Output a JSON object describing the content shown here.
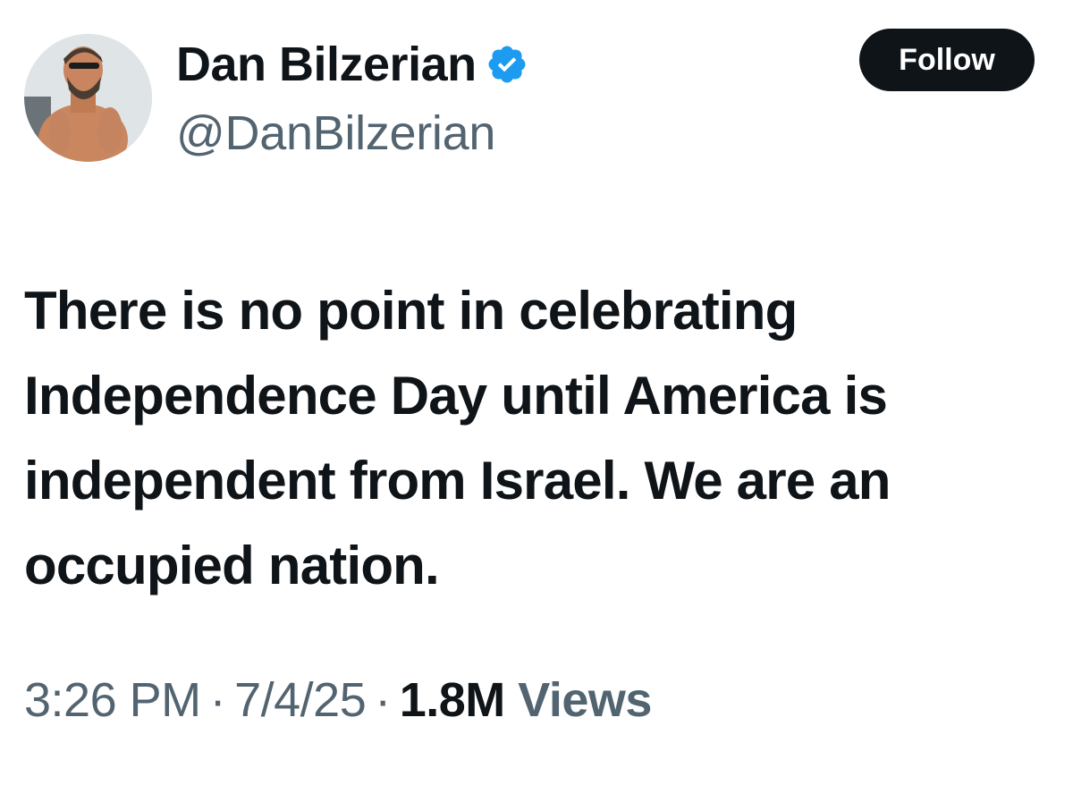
{
  "author": {
    "display_name": "Dan Bilzerian",
    "handle": "@DanBilzerian",
    "verified": true,
    "avatar_icon": "profile-photo"
  },
  "actions": {
    "follow_label": "Follow"
  },
  "tweet": {
    "text": "There is no point in celebrating Independence Day until America is independent from Israel. We are an occupied nation."
  },
  "meta": {
    "time": "3:26 PM",
    "separator": "·",
    "date": "7/4/25",
    "views_count": "1.8M",
    "views_label": "Views"
  },
  "colors": {
    "text_primary": "#0f1419",
    "text_secondary": "#536471",
    "verified_badge": "#1d9bf0",
    "follow_button_bg": "#0f1419"
  }
}
